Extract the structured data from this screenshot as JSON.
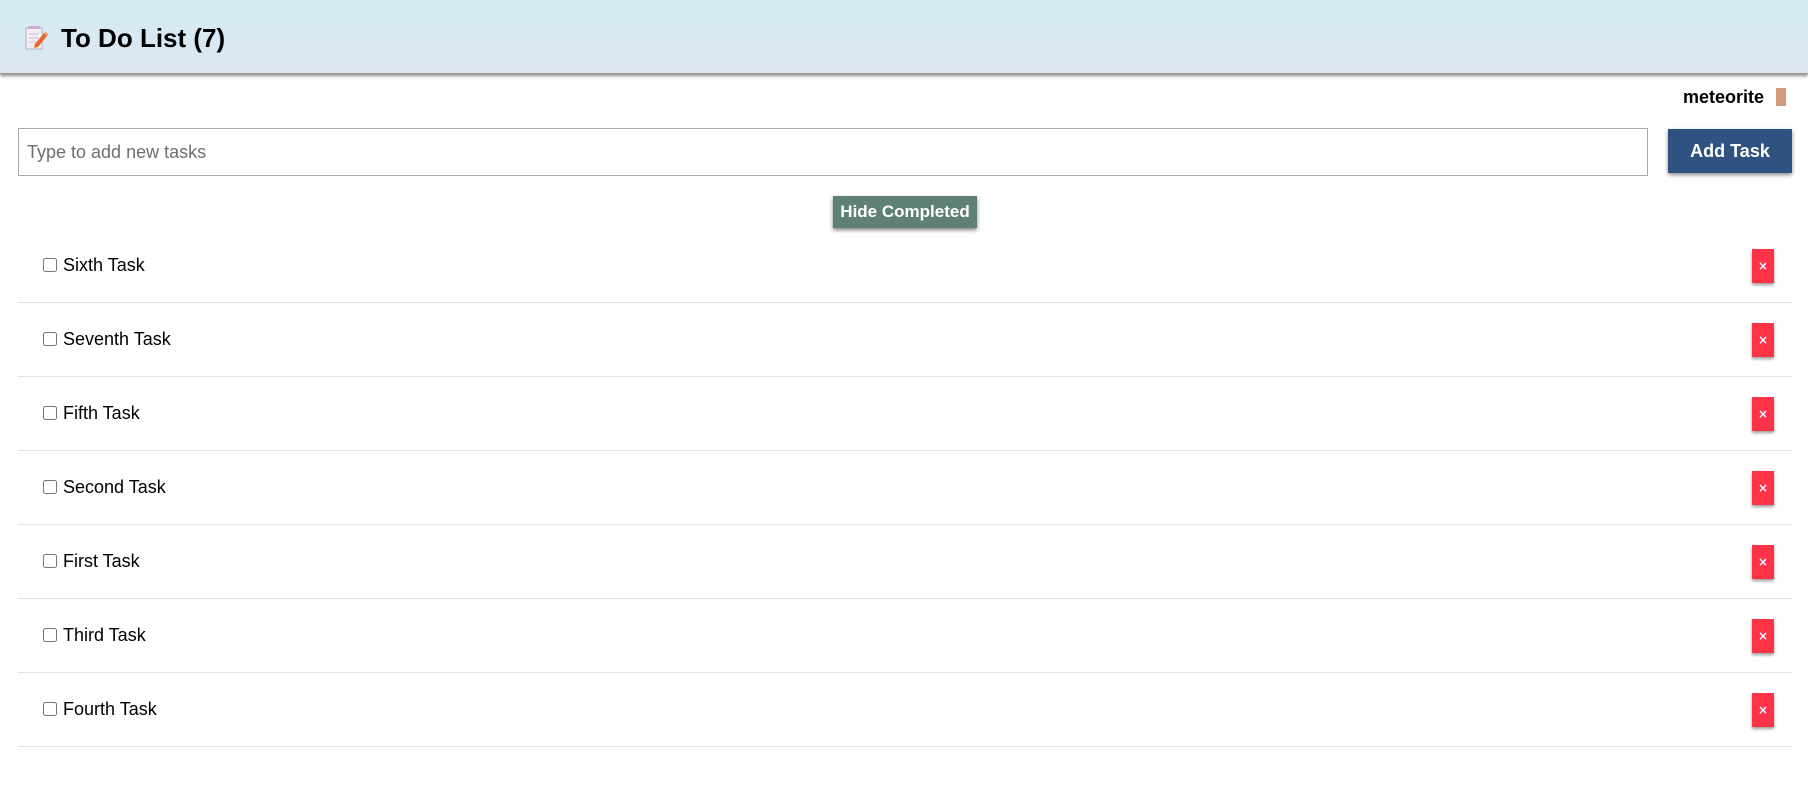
{
  "header": {
    "title": "To Do List (7)",
    "icon": "notepad-pencil-icon"
  },
  "user": {
    "name": "meteorite"
  },
  "new_task": {
    "placeholder": "Type to add new tasks",
    "value": "",
    "add_label": "Add Task"
  },
  "filter": {
    "hide_completed_label": "Hide Completed"
  },
  "tasks": [
    {
      "label": "Sixth Task",
      "checked": false,
      "delete_label": "×"
    },
    {
      "label": "Seventh Task",
      "checked": false,
      "delete_label": "×"
    },
    {
      "label": "Fifth Task",
      "checked": false,
      "delete_label": "×"
    },
    {
      "label": "Second Task",
      "checked": false,
      "delete_label": "×"
    },
    {
      "label": "First Task",
      "checked": false,
      "delete_label": "×"
    },
    {
      "label": "Third Task",
      "checked": false,
      "delete_label": "×"
    },
    {
      "label": "Fourth Task",
      "checked": false,
      "delete_label": "×"
    }
  ],
  "colors": {
    "header_bg_top": "#d3ecf3",
    "header_bg_bottom": "#dde6f1",
    "add_button": "#2f5280",
    "hide_button": "#5f8077",
    "delete_button": "#ff3348",
    "user_caret": "#d59a7c"
  }
}
